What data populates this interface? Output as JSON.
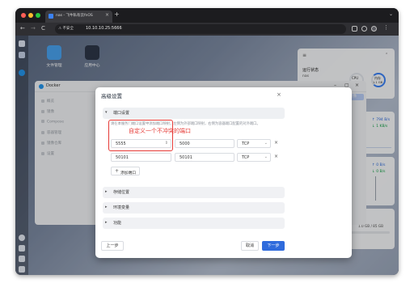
{
  "browser": {
    "tab_title": "nas - 飞牛私有云fnOS",
    "tab_close": "×",
    "new_tab": "+",
    "tabs_menu": "⌄",
    "back": "←",
    "forward": "→",
    "reload": "C",
    "security_label": "不安全",
    "url": "10.10.10.25:5666"
  },
  "desktop": {
    "apps": [
      {
        "label": "文件管理",
        "icon": "folder-icon",
        "color": "#4aa3f0"
      },
      {
        "label": "应用中心",
        "icon": "app-center-icon",
        "color": "#2d3748"
      }
    ]
  },
  "widgets": {
    "status_title": "运行状态",
    "host": "nas",
    "cpu_label": "CPU",
    "cpu_value": "1%",
    "mem_label": "内存",
    "mem_value": "1.1 GB",
    "net_up": "↑ 794 B/s",
    "net_down": "↓ 1 KB/s",
    "disk_up": "↑ 0 B/s",
    "disk_down": "↓ 0 B/s",
    "disk_summary": "1.0 GB / 85 GB"
  },
  "docker": {
    "title": "Docker",
    "sidebar": [
      "概览",
      "镜像",
      "Compose",
      "容器管理",
      "镜像仓库",
      "设置"
    ],
    "delete_label": "删除",
    "add_label": "添加镜像"
  },
  "modal": {
    "title": "高级设置",
    "close": "×",
    "sections": {
      "ports": "端口设置",
      "storage": "存储位置",
      "env": "环境变量",
      "functions": "功能"
    },
    "hint": "请在本服务门端口设置中添加端口映射，左侧为外部端口映射，右侧为容器端口配置的对外端口。",
    "port_rows": [
      {
        "host": "5555",
        "container": "5000",
        "protocol": "TCP"
      },
      {
        "host": "50101",
        "container": "50101",
        "protocol": "TCP"
      }
    ],
    "remove": "×",
    "add_port": "添加端口",
    "prev": "上一步",
    "cancel": "取消",
    "next": "下一步",
    "annotation": "自定义一个不冲突的端口"
  },
  "colors": {
    "primary": "#2f6bdc",
    "annotation": "#e53935"
  }
}
